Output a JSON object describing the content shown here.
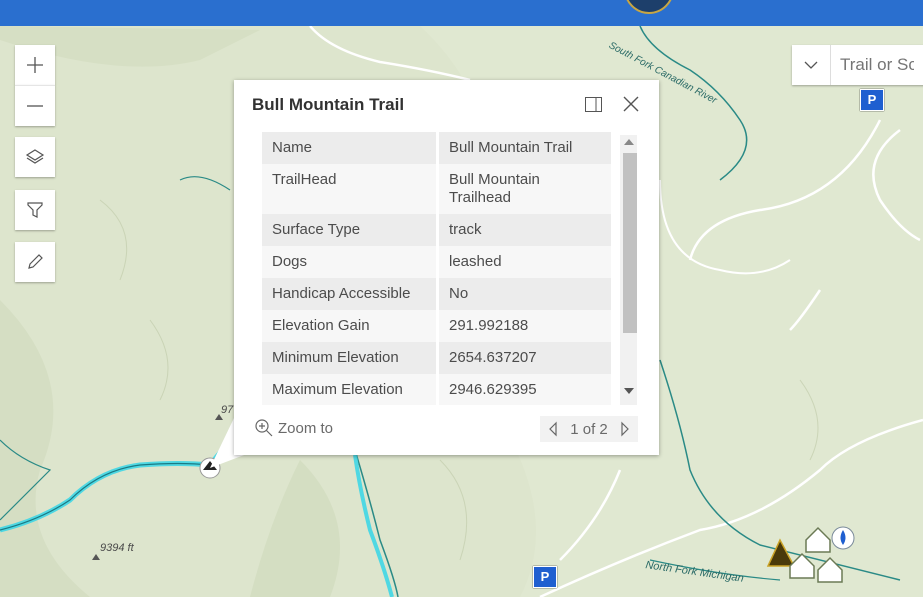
{
  "map": {
    "labels": {
      "river_south": "South Fork Canadian River",
      "river_north": "North Fork Michigan",
      "elev_1": "9394 ft",
      "elev_2": "97"
    },
    "parking_label": "P"
  },
  "controls": {
    "zoom_in_icon": "plus-icon",
    "zoom_out_icon": "minus-icon",
    "layers_icon": "layers-icon",
    "filter_icon": "filter-icon",
    "draw_icon": "pencil-icon"
  },
  "search": {
    "placeholder": "Trail or Sce",
    "dropdown_icon": "chevron-down-icon"
  },
  "popup": {
    "title": "Bull Mountain Trail",
    "fields": [
      {
        "key": "Name",
        "value": "Bull Mountain Trail"
      },
      {
        "key": "TrailHead",
        "value": "Bull Mountain Trailhead"
      },
      {
        "key": "Surface Type",
        "value": "track"
      },
      {
        "key": "Dogs",
        "value": "leashed"
      },
      {
        "key": "Handicap Accessible",
        "value": "No"
      },
      {
        "key": "Elevation Gain",
        "value": "291.992188"
      },
      {
        "key": "Minimum Elevation",
        "value": "2654.637207"
      },
      {
        "key": "Maximum Elevation",
        "value": "2946.629395"
      }
    ],
    "zoom_label": "Zoom to",
    "pager_text": "1 of 2"
  },
  "colors": {
    "header": "#2a6fcf",
    "trail_highlight": "#3fd6e6",
    "river": "#2a8a86",
    "parking": "#1f5fd0"
  }
}
